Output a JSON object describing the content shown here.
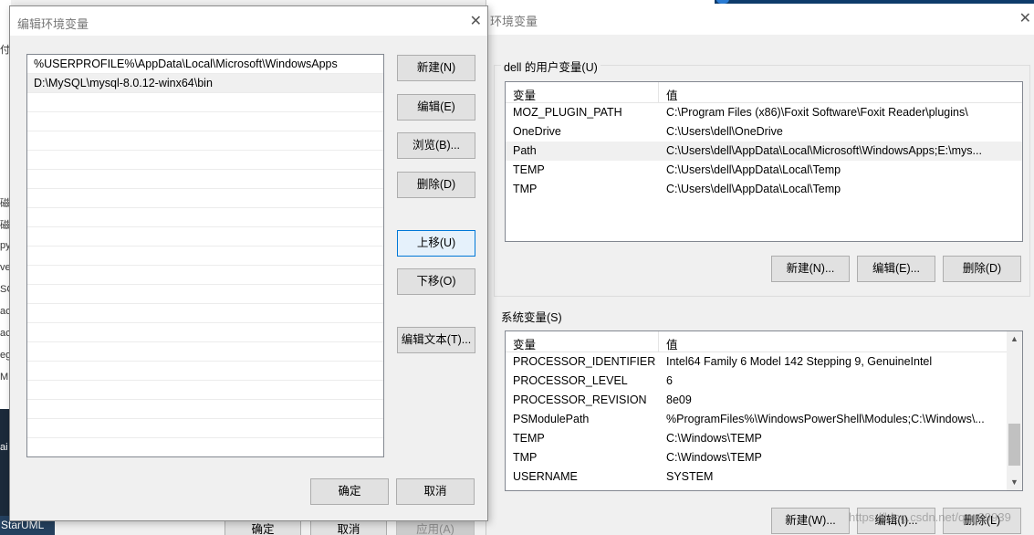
{
  "desktop": {
    "fragments": [
      "付",
      "磁",
      "磁",
      "py",
      "ve",
      "SC",
      "ac",
      "ac",
      "eg",
      "MD",
      "ai"
    ],
    "taskbar_label": "StarUML"
  },
  "env_window": {
    "title": "环境变量",
    "user_group_label": "dell 的用户变量(U)",
    "user_columns": [
      "变量",
      "值"
    ],
    "user_vars": [
      {
        "name": "MOZ_PLUGIN_PATH",
        "value": "C:\\Program Files (x86)\\Foxit Software\\Foxit Reader\\plugins\\"
      },
      {
        "name": "OneDrive",
        "value": "C:\\Users\\dell\\OneDrive"
      },
      {
        "name": "Path",
        "value": "C:\\Users\\dell\\AppData\\Local\\Microsoft\\WindowsApps;E:\\mys..."
      },
      {
        "name": "TEMP",
        "value": "C:\\Users\\dell\\AppData\\Local\\Temp"
      },
      {
        "name": "TMP",
        "value": "C:\\Users\\dell\\AppData\\Local\\Temp"
      }
    ],
    "user_selected_index": 2,
    "user_buttons": {
      "new": "新建(N)...",
      "edit": "编辑(E)...",
      "delete": "删除(D)"
    },
    "sys_group_label": "系统变量(S)",
    "sys_columns": [
      "变量",
      "值"
    ],
    "sys_vars": [
      {
        "name": "PROCESSOR_IDENTIFIER",
        "value": "Intel64 Family 6 Model 142 Stepping 9, GenuineIntel"
      },
      {
        "name": "PROCESSOR_LEVEL",
        "value": "6"
      },
      {
        "name": "PROCESSOR_REVISION",
        "value": "8e09"
      },
      {
        "name": "PSModulePath",
        "value": "%ProgramFiles%\\WindowsPowerShell\\Modules;C:\\Windows\\..."
      },
      {
        "name": "TEMP",
        "value": "C:\\Windows\\TEMP"
      },
      {
        "name": "TMP",
        "value": "C:\\Windows\\TEMP"
      },
      {
        "name": "USERNAME",
        "value": "SYSTEM"
      }
    ],
    "sys_buttons": {
      "new": "新建(W)...",
      "edit": "编辑(I)...",
      "delete": "删除(L)"
    },
    "watermark": "https://blog.csdn.net/qq_39939"
  },
  "bottom_buttons": {
    "ok": "确定",
    "cancel": "取消",
    "apply": "应用(A)"
  },
  "edit_dialog": {
    "title": "编辑环境变量",
    "entries": [
      "%USERPROFILE%\\AppData\\Local\\Microsoft\\WindowsApps",
      "D:\\MySQL\\mysql-8.0.12-winx64\\bin"
    ],
    "selected_index": 1,
    "empty_rows": 19,
    "buttons": {
      "new": "新建(N)",
      "edit": "编辑(E)",
      "browse": "浏览(B)...",
      "delete": "删除(D)",
      "move_up": "上移(U)",
      "move_down": "下移(O)",
      "edit_text": "编辑文本(T)..."
    },
    "ok": "确定",
    "cancel": "取消"
  },
  "colors": {
    "focus_border": "#0078d7",
    "selection": "#f0f0f0"
  }
}
